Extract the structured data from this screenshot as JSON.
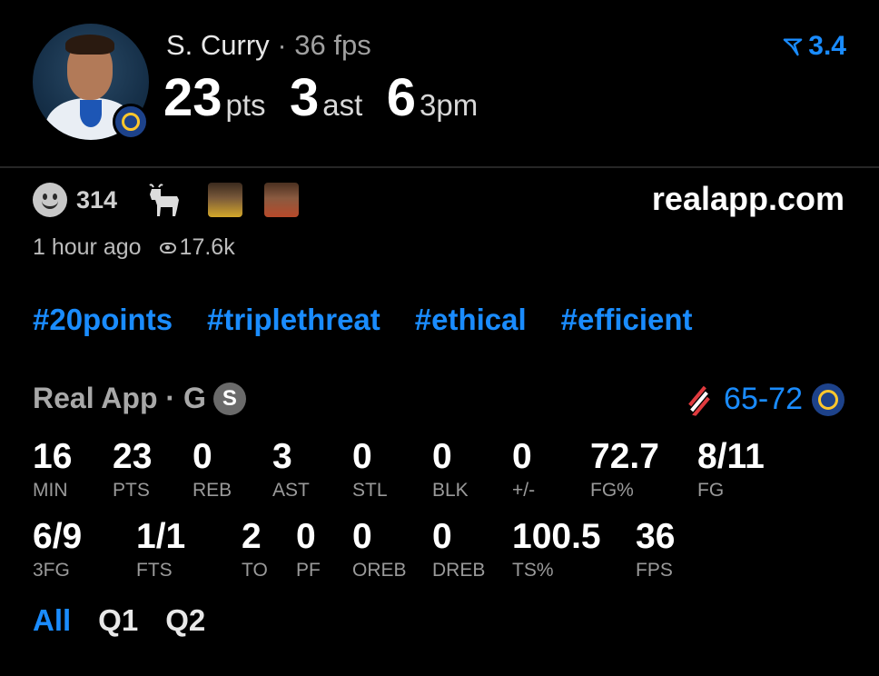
{
  "player": {
    "name": "S. Curry",
    "separator": "·",
    "fps_label": "36 fps",
    "stats": [
      {
        "value": "23",
        "unit": "pts"
      },
      {
        "value": "3",
        "unit": "ast"
      },
      {
        "value": "6",
        "unit": "3pm"
      }
    ],
    "rating": "3.4",
    "accent_color": "#1a8cff"
  },
  "social": {
    "reaction_count": "314",
    "site": "realapp.com",
    "time_ago": "1 hour ago",
    "views": "17.6k"
  },
  "tags": [
    "#20points",
    "#triplethreat",
    "#ethical",
    "#efficient"
  ],
  "game": {
    "source": "Real App · G",
    "source_badge": "S",
    "score": "65-72",
    "away_team_icon": "blazers-logo",
    "home_team_icon": "warriors-logo"
  },
  "boxscore": {
    "row1": [
      {
        "value": "16",
        "label": "MIN"
      },
      {
        "value": "23",
        "label": "PTS"
      },
      {
        "value": "0",
        "label": "REB"
      },
      {
        "value": "3",
        "label": "AST"
      },
      {
        "value": "0",
        "label": "STL"
      },
      {
        "value": "0",
        "label": "BLK"
      },
      {
        "value": "0",
        "label": "+/-"
      },
      {
        "value": "72.7",
        "label": "FG%"
      },
      {
        "value": "8/11",
        "label": "FG"
      }
    ],
    "row2": [
      {
        "value": "6/9",
        "label": "3FG"
      },
      {
        "value": "1/1",
        "label": "FTS"
      },
      {
        "value": "2",
        "label": "TO"
      },
      {
        "value": "0",
        "label": "PF"
      },
      {
        "value": "0",
        "label": "OREB"
      },
      {
        "value": "0",
        "label": "DREB"
      },
      {
        "value": "100.5",
        "label": "TS%"
      },
      {
        "value": "36",
        "label": "FPS"
      }
    ]
  },
  "periods": [
    {
      "label": "All",
      "active": true
    },
    {
      "label": "Q1",
      "active": false
    },
    {
      "label": "Q2",
      "active": false
    }
  ]
}
